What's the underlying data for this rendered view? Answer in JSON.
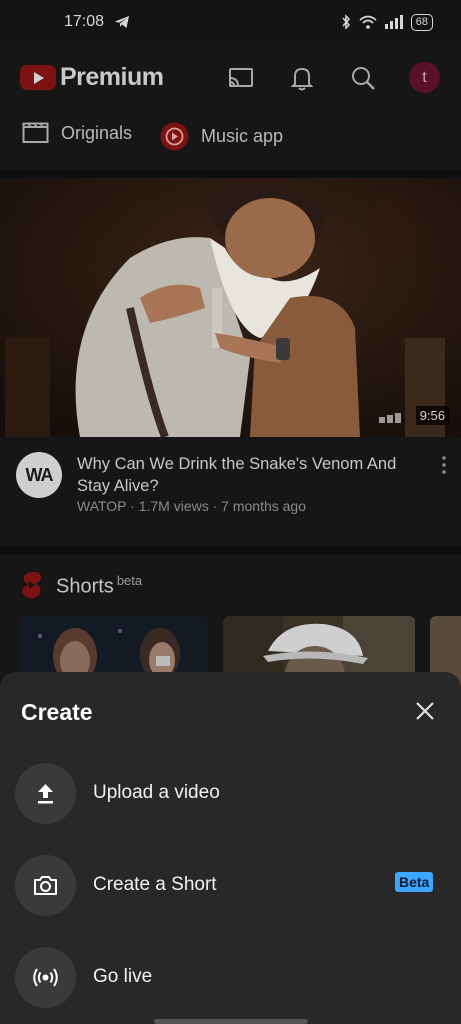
{
  "status_bar": {
    "time": "17:08",
    "battery": "68",
    "icons": [
      "telegram-icon",
      "bluetooth-icon",
      "wifi-icon",
      "signal-icon",
      "battery-icon"
    ]
  },
  "header": {
    "brand": "Premium",
    "avatar_letter": "t",
    "icons": [
      "cast-icon",
      "bell-icon",
      "search-icon"
    ]
  },
  "chips": [
    {
      "label": "Originals",
      "icon": "clapperboard-icon"
    },
    {
      "label": "Music app",
      "icon": "music-app-icon"
    }
  ],
  "video": {
    "duration": "9:56",
    "title": "Why Can We Drink the Snake's Venom And Stay Alive?",
    "channel_avatar_text": "WA",
    "meta": "WATOP · 1.7M views · 7 months ago"
  },
  "shorts": {
    "title": "Shorts",
    "badge": "beta"
  },
  "sheet": {
    "title": "Create",
    "options": [
      {
        "label": "Upload a video",
        "icon": "upload-icon"
      },
      {
        "label": "Create a Short",
        "icon": "camera-icon",
        "badge": "Beta"
      },
      {
        "label": "Go live",
        "icon": "live-broadcast-icon"
      }
    ]
  },
  "colors": {
    "brand_red": "#7d1212",
    "beta_badge": "#3ea6ff",
    "sheet_bg": "#282828"
  }
}
